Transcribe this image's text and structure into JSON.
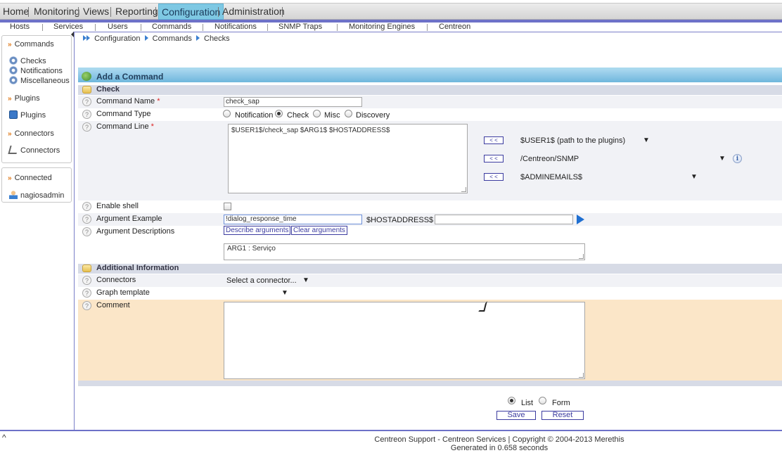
{
  "main_nav": [
    {
      "label": "Home",
      "active": false
    },
    {
      "label": "Monitoring",
      "active": false
    },
    {
      "label": "Views",
      "active": false
    },
    {
      "label": "Reporting",
      "active": false
    },
    {
      "label": "Configuration",
      "active": true
    },
    {
      "label": "Administration",
      "active": false
    }
  ],
  "sub_nav": [
    "Hosts",
    "Services",
    "Users",
    "Commands",
    "Notifications",
    "SNMP Traps",
    "Monitoring Engines",
    "Centreon"
  ],
  "sidebar": {
    "commands_header": "Commands",
    "commands_items": [
      "Checks",
      "Notifications",
      "Miscellaneous"
    ],
    "plugins_header": "Plugins",
    "plugins_items": [
      "Plugins"
    ],
    "connectors_header": "Connectors",
    "connectors_items": [
      "Connectors"
    ],
    "connected_header": "Connected",
    "connected_user": "nagiosadmin"
  },
  "breadcrumb": [
    "Configuration",
    "Commands",
    "Checks"
  ],
  "form": {
    "title": "Add a Command",
    "check_section": "Check",
    "labels": {
      "command_name": "Command Name",
      "command_type": "Command Type",
      "command_line": "Command Line",
      "enable_shell": "Enable shell",
      "argument_example": "Argument Example",
      "argument_descriptions": "Argument Descriptions",
      "connectors": "Connectors",
      "graph_template": "Graph template",
      "comment": "Comment"
    },
    "required_mark": "*",
    "command_name_value": "check_sap",
    "command_types": [
      "Notification",
      "Check",
      "Misc",
      "Discovery"
    ],
    "command_type_selected": "Check",
    "command_line_value": "$USER1$/check_sap $ARG1$ $HOSTADDRESS$",
    "macro_button": "< <",
    "macro_selects": [
      "$USER1$ (path to the plugins)",
      "/Centreon/SNMP",
      "$ADMINEMAILS$"
    ],
    "enable_shell_checked": false,
    "argument_example_value": "!dialog_response_time",
    "hostaddress_label": "$HOSTADDRESS$",
    "hostaddress_value": "",
    "describe_arguments": "Describe arguments",
    "clear_arguments": "Clear arguments",
    "argument_descriptions_value": "ARG1 : Serviço",
    "additional_section": "Additional Information",
    "connectors_placeholder": "Select a connector...",
    "graph_template_value": "",
    "comment_value": ""
  },
  "actions": {
    "view_options": [
      "List",
      "Form"
    ],
    "view_selected": "List",
    "save": "Save",
    "reset": "Reset"
  },
  "footer": {
    "line1": "Centreon Support - Centreon Services | Copyright © 2004-2013 Merethis",
    "line2": "Generated in 0.658 seconds",
    "back_to_top": "^"
  },
  "colors": {
    "accent": "#6d71c8",
    "active_tab": "#7ec8e3",
    "title_bar": "#6fb7dc",
    "comment_bg": "#fbe6c8"
  }
}
